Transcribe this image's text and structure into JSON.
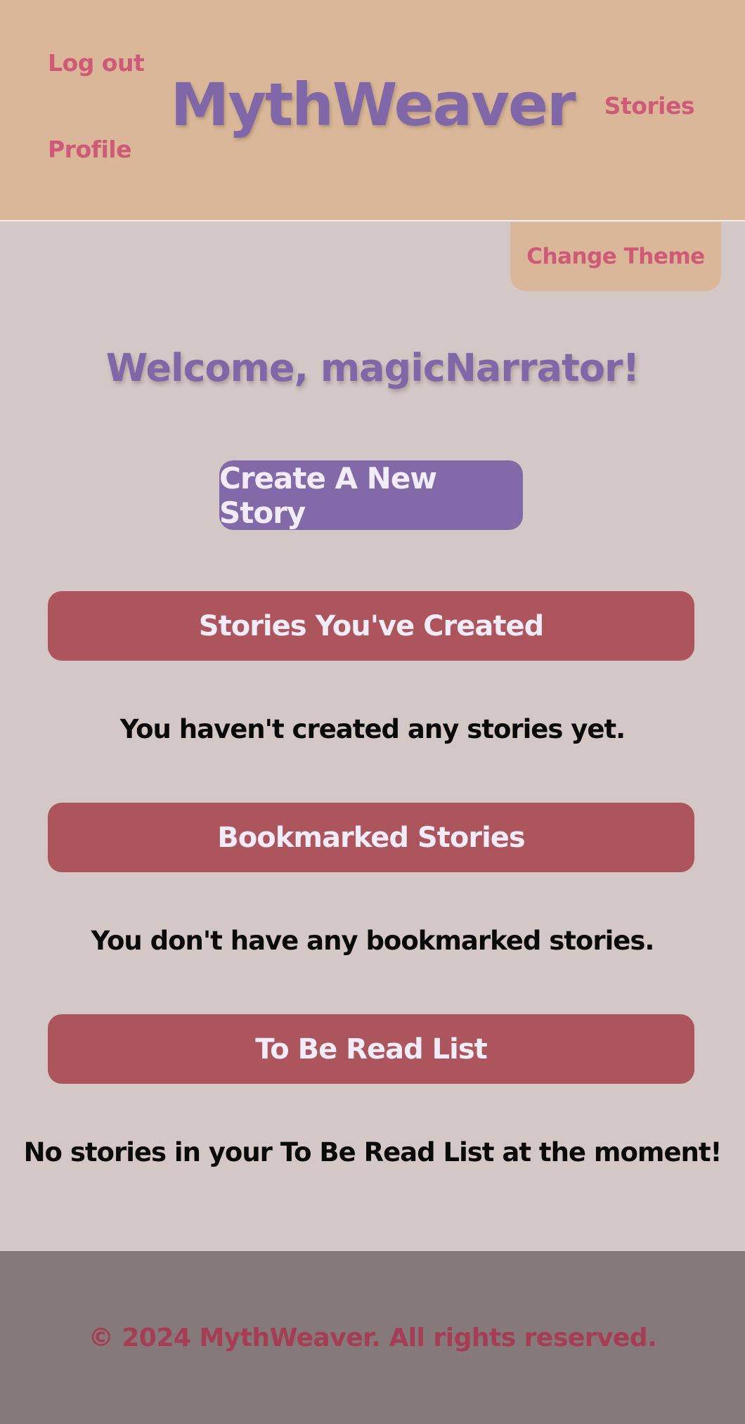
{
  "header": {
    "brand": "MythWeaver",
    "nav": {
      "logout_label": "Log out",
      "profile_label": "Profile",
      "stories_label": "Stories"
    }
  },
  "theme": {
    "button_label": "Change Theme"
  },
  "main": {
    "welcome": "Welcome, magicNarrator!",
    "create_button_label": "Create A New Story",
    "sections": [
      {
        "title": "Stories You've Created",
        "empty_message": "You haven't created any stories yet."
      },
      {
        "title": "Bookmarked Stories",
        "empty_message": "You don't have any bookmarked stories."
      },
      {
        "title": "To Be Read List",
        "empty_message": "No stories in your To Be Read List at the moment!"
      }
    ]
  },
  "footer": {
    "copyright": "© 2024 MythWeaver. All rights reserved."
  },
  "colors": {
    "header_bg": "#d9b798",
    "page_bg": "#d3c8c6",
    "accent_purple": "#826aa8",
    "section_red": "#ad555c",
    "link_pink": "#cf5a78",
    "footer_bg": "#857a79",
    "footer_text": "#a63d55"
  }
}
